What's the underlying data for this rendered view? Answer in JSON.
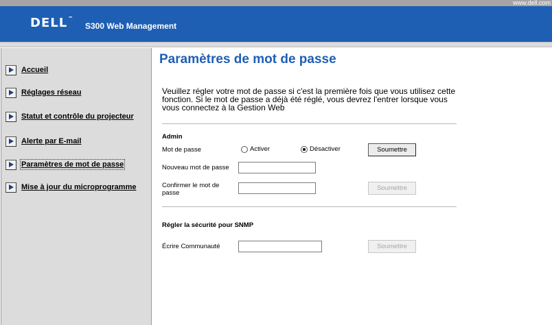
{
  "topbar": {
    "url": "www.dell.com"
  },
  "header": {
    "logo": "DELL",
    "app_name": "S300 Web Management"
  },
  "sidebar": {
    "items": [
      {
        "label": "Accueil",
        "icon": "arrow-right-icon"
      },
      {
        "label": "Réglages réseau",
        "icon": "arrow-right-icon"
      },
      {
        "label": "Statut et contrôle du projecteur",
        "icon": "arrow-right-icon"
      },
      {
        "label": "Alerte par E-mail",
        "icon": "arrow-right-icon"
      },
      {
        "label": "Paramètres de mot de passe",
        "icon": "arrow-right-icon",
        "active": true
      },
      {
        "label": "Mise à jour du microprogramme",
        "icon": "arrow-right-icon"
      }
    ]
  },
  "main": {
    "title": "Paramètres de mot de passe",
    "intro": "Veuillez régler votre mot de passe si c'est la première fois que vous utilisez cette fonction. Si le mot de passe a déjà été réglé, vous devrez l'entrer lorsque vous vous connectez à la Gestion Web",
    "admin": {
      "heading": "Admin",
      "password_label": "Mot de passe",
      "enable_label": "Activer",
      "disable_label": "Désactiver",
      "selected": "Désactiver",
      "submit_label": "Soumettre",
      "new_password_label": "Nouveau mot de passe",
      "new_password_value": "",
      "confirm_password_label": "Confirmer le mot de passe",
      "confirm_password_value": "",
      "confirm_submit_label": "Soumettre"
    },
    "snmp": {
      "heading": "Régler la sécurité pour SNMP",
      "community_label": "Écrire Communauté",
      "community_value": "",
      "submit_label": "Soumettre"
    }
  },
  "colors": {
    "header_blue": "#1e5fb4",
    "sidebar_grey": "#dcdcdc",
    "title_blue": "#1e5fb4"
  }
}
